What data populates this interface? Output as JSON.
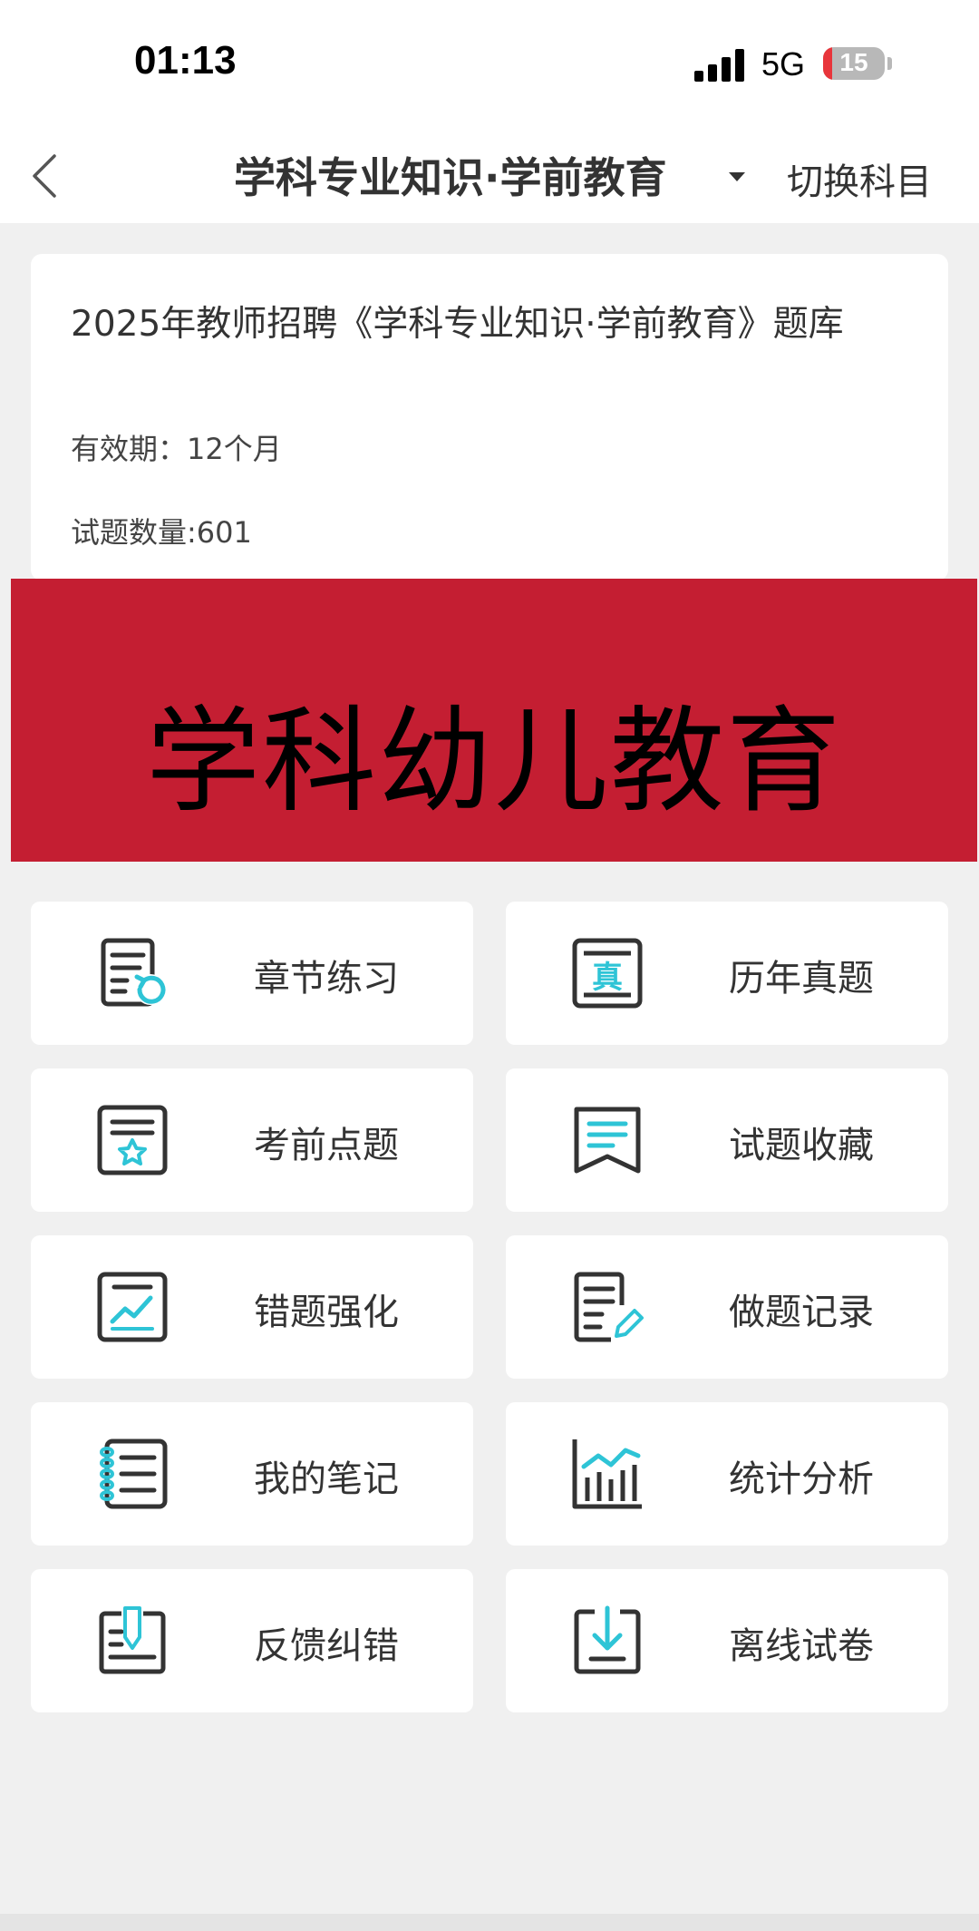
{
  "status": {
    "time": "01:13",
    "network": "5G",
    "battery": "15",
    "battery_level": 0.15
  },
  "nav": {
    "title": "学科专业知识·学前教育",
    "switch_label": "切换科目"
  },
  "info": {
    "title": "2025年教师招聘《学科专业知识·学前教育》题库",
    "validity": "有效期：12个月",
    "count": "试题数量:601"
  },
  "banner": {
    "text": "学科幼儿教育",
    "background": "#c41e32"
  },
  "menu": [
    {
      "label": "章节练习",
      "icon": "chapter-practice-icon"
    },
    {
      "label": "历年真题",
      "icon": "past-exam-icon"
    },
    {
      "label": "考前点题",
      "icon": "pre-exam-star-icon"
    },
    {
      "label": "试题收藏",
      "icon": "bookmark-icon"
    },
    {
      "label": "错题强化",
      "icon": "wrong-answer-chart-icon"
    },
    {
      "label": "做题记录",
      "icon": "record-edit-icon"
    },
    {
      "label": "我的笔记",
      "icon": "notebook-icon"
    },
    {
      "label": "统计分析",
      "icon": "statistics-icon"
    },
    {
      "label": "反馈纠错",
      "icon": "feedback-pen-icon"
    },
    {
      "label": "离线试卷",
      "icon": "download-icon"
    }
  ],
  "colors": {
    "accent": "#2ec4d6",
    "icon_dark": "#333333"
  }
}
